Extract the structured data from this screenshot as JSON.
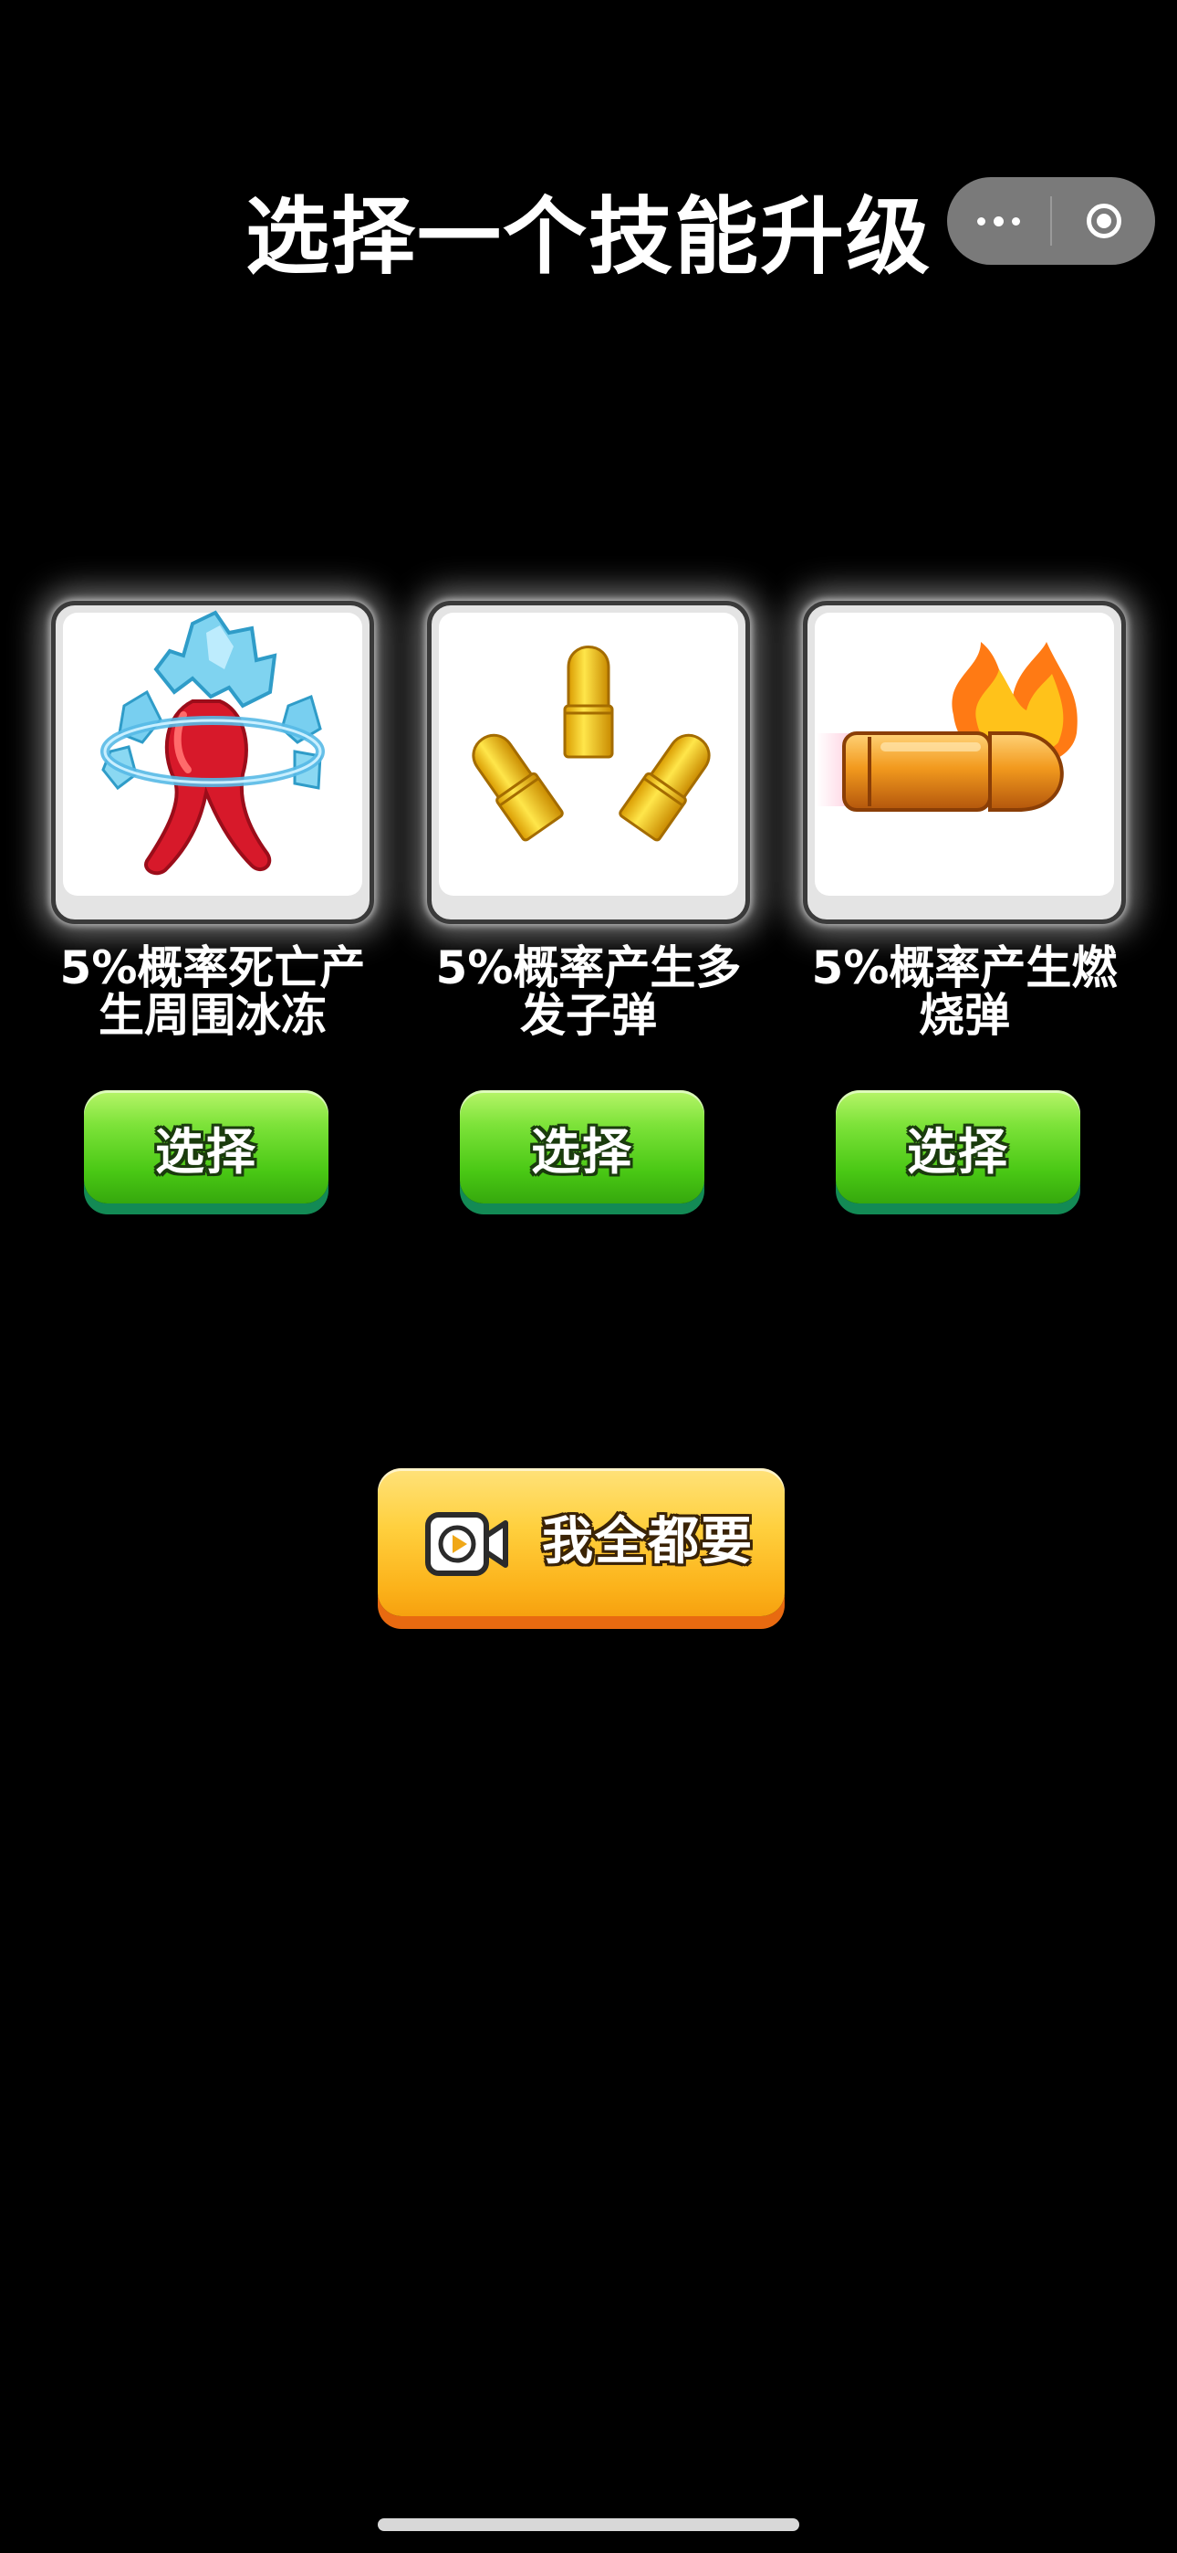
{
  "header": {
    "title": "选择一个技能升级"
  },
  "capsule": {
    "more_icon": "more-dots-icon",
    "close_icon": "target-circle-icon"
  },
  "skills": [
    {
      "icon": "ice-freeze-icon",
      "description": "5%概率死亡产生周围冰冻",
      "select_label": "选择"
    },
    {
      "icon": "multi-bullet-icon",
      "description": "5%概率产生多发子弹",
      "select_label": "选择"
    },
    {
      "icon": "fire-bullet-icon",
      "description": "5%概率产生燃烧弹",
      "select_label": "选择"
    }
  ],
  "get_all": {
    "icon": "video-camera-icon",
    "label": "我全都要"
  },
  "colors": {
    "background": "#000000",
    "select_button": "#49c814",
    "get_all_button": "#fcb31b"
  }
}
